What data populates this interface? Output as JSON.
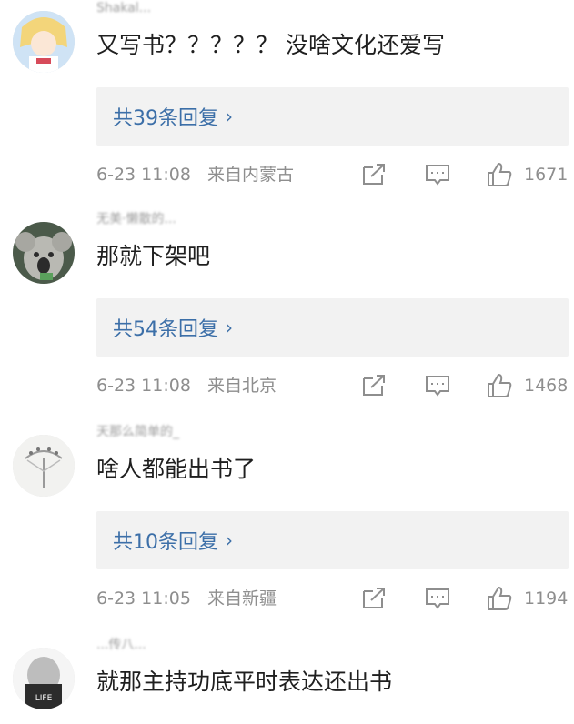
{
  "comments": [
    {
      "username": "Shakal...",
      "text": "又写书？？？？？ 没啥文化还爱写",
      "replies": "共39条回复",
      "time": "6-23 11:08",
      "location": "来自内蒙古",
      "likes": "1671",
      "avatar_colors": [
        "#cfe3f5",
        "#f3d57a",
        "#b7d8ee"
      ]
    },
    {
      "username": "无美·懒散的...",
      "text": "那就下架吧",
      "replies": "共54条回复",
      "time": "6-23 11:08",
      "location": "来自北京",
      "likes": "1468",
      "avatar_colors": [
        "#4b5a4a",
        "#b9b9b3",
        "#2b2b2b"
      ]
    },
    {
      "username": "天那么简单的_",
      "text": "啥人都能出书了",
      "replies": "共10条回复",
      "time": "6-23 11:05",
      "location": "来自新疆",
      "likes": "1194",
      "avatar_colors": [
        "#f2f2f0",
        "#9a9a9a",
        "#cfcfcf"
      ]
    },
    {
      "username": "...传八...",
      "text": "就那主持功底平时表达还出书",
      "avatar_colors": [
        "#f5f5f5",
        "#2c2c2c",
        "#bdbdbd"
      ]
    }
  ],
  "colors": {
    "link": "#3c6fa8",
    "meta": "#8e8e8e",
    "reply_bg": "#f2f2f2"
  },
  "icons": {
    "share": "share-icon",
    "comment": "comment-icon",
    "like": "thumbs-up-icon"
  }
}
